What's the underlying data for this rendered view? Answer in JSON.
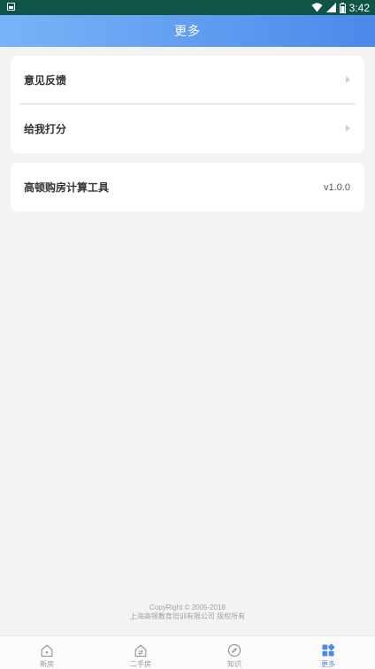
{
  "status_bar": {
    "time": "3:42"
  },
  "header": {
    "title": "更多"
  },
  "card1": {
    "items": [
      {
        "label": "意见反馈"
      },
      {
        "label": "给我打分"
      }
    ]
  },
  "card2": {
    "app_name": "高顿购房计算工具",
    "version": "v1.0.0"
  },
  "footer": {
    "copyright": "CopyRight © 2005-2018",
    "company": "上海高顿教育培训有限公司 版权所有"
  },
  "tabs": [
    {
      "label": "新房",
      "icon": "new-house-icon"
    },
    {
      "label": "二手房",
      "icon": "second-hand-house-icon"
    },
    {
      "label": "知识",
      "icon": "compass-icon"
    },
    {
      "label": "更多",
      "icon": "grid-icon"
    }
  ],
  "colors": {
    "accent": "#4a89ea",
    "status_bar": "#0e5547"
  }
}
